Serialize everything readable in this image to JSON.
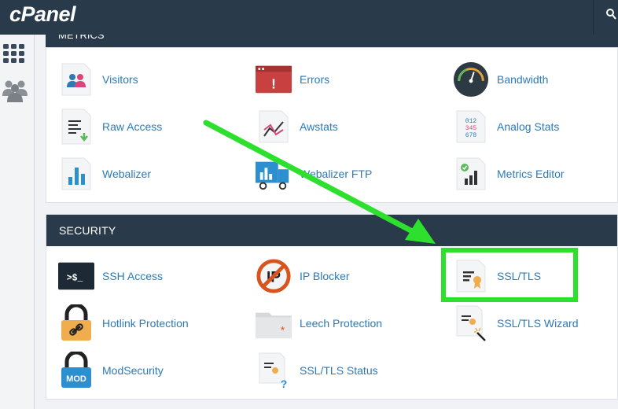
{
  "app": {
    "logo": "cPanel"
  },
  "header": {
    "search_icon": "search-icon"
  },
  "sidebar": {
    "icons": [
      "grid-icon",
      "users-icon"
    ]
  },
  "metrics": {
    "title": "METRICS",
    "items": [
      {
        "label": "Visitors",
        "icon": "visitors-icon"
      },
      {
        "label": "Errors",
        "icon": "errors-icon"
      },
      {
        "label": "Bandwidth",
        "icon": "bandwidth-icon"
      },
      {
        "label": "Raw Access",
        "icon": "raw-access-icon"
      },
      {
        "label": "Awstats",
        "icon": "awstats-icon"
      },
      {
        "label": "Analog Stats",
        "icon": "analog-stats-icon"
      },
      {
        "label": "Webalizer",
        "icon": "webalizer-icon"
      },
      {
        "label": "Webalizer FTP",
        "icon": "webalizer-ftp-icon"
      },
      {
        "label": "Metrics Editor",
        "icon": "metrics-editor-icon"
      }
    ]
  },
  "security": {
    "title": "SECURITY",
    "items": [
      {
        "label": "SSH Access",
        "icon": "ssh-access-icon"
      },
      {
        "label": "IP Blocker",
        "icon": "ip-blocker-icon"
      },
      {
        "label": "SSL/TLS",
        "icon": "ssl-tls-icon"
      },
      {
        "label": "Hotlink Protection",
        "icon": "hotlink-protection-icon"
      },
      {
        "label": "Leech Protection",
        "icon": "leech-protection-icon"
      },
      {
        "label": "SSL/TLS Wizard",
        "icon": "ssl-tls-wizard-icon"
      },
      {
        "label": "ModSecurity",
        "icon": "modsecurity-icon"
      },
      {
        "label": "SSL/TLS Status",
        "icon": "ssl-tls-status-icon"
      }
    ]
  },
  "icon_text": {
    "errors": "!",
    "ssh": ">$_",
    "ip": "IP",
    "mod": "MOD",
    "analog_row1": "012",
    "analog_row2": "345",
    "analog_row3": "678"
  },
  "colors": {
    "header_bg": "#293a4a",
    "link": "#2c7ab8",
    "highlight": "#2ee02e"
  }
}
